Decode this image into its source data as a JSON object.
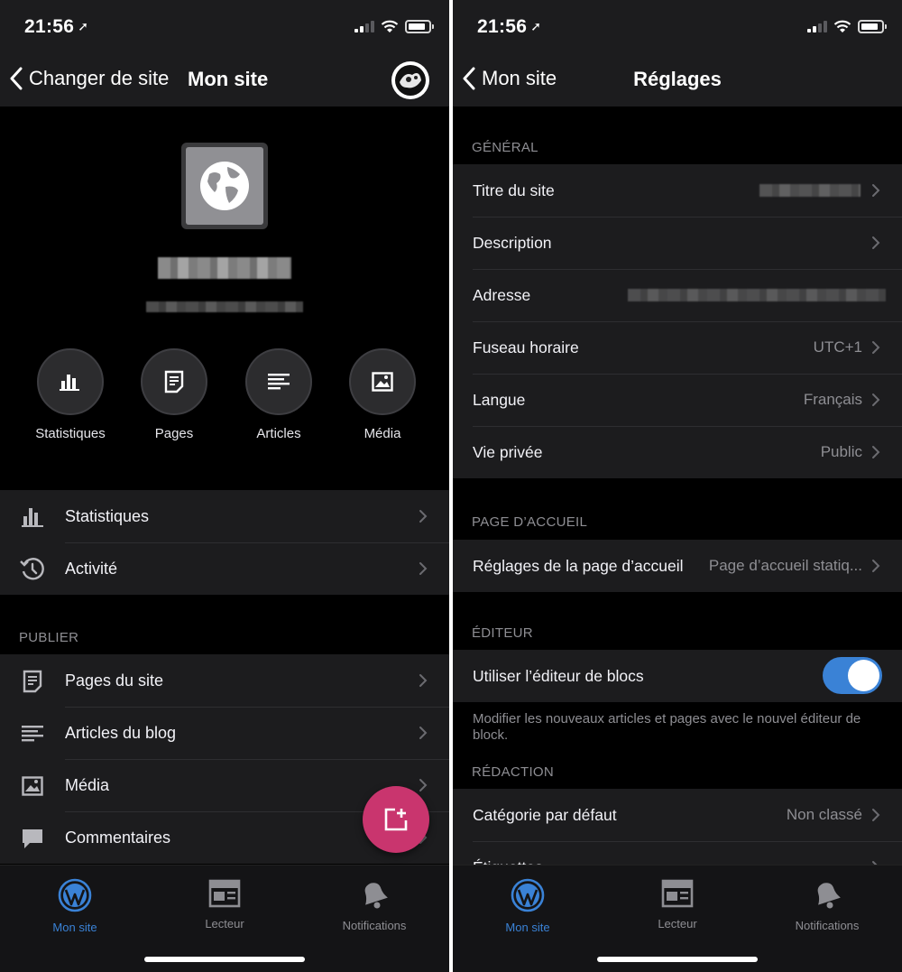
{
  "left": {
    "status": {
      "time": "21:56"
    },
    "nav": {
      "back_label": "Changer de site",
      "title": "Mon site"
    },
    "quick_actions": [
      {
        "label": "Statistiques",
        "icon": "stats-icon"
      },
      {
        "label": "Pages",
        "icon": "pages-icon"
      },
      {
        "label": "Articles",
        "icon": "articles-icon"
      },
      {
        "label": "Média",
        "icon": "media-icon"
      }
    ],
    "group1": [
      {
        "label": "Statistiques",
        "icon": "stats-icon"
      },
      {
        "label": "Activité",
        "icon": "history-icon"
      }
    ],
    "publish_header": "PUBLIER",
    "publish": [
      {
        "label": "Pages du site",
        "icon": "pages-icon"
      },
      {
        "label": "Articles du blog",
        "icon": "articles-icon"
      },
      {
        "label": "Média",
        "icon": "media-icon"
      },
      {
        "label": "Commentaires",
        "icon": "comment-icon"
      }
    ]
  },
  "right": {
    "status": {
      "time": "21:56"
    },
    "nav": {
      "back_label": "Mon site",
      "title": "Réglages"
    },
    "general_header": "GÉNÉRAL",
    "general": [
      {
        "label": "Titre du site",
        "value": ""
      },
      {
        "label": "Description",
        "value": ""
      },
      {
        "label": "Adresse",
        "value": ""
      },
      {
        "label": "Fuseau horaire",
        "value": "UTC+1"
      },
      {
        "label": "Langue",
        "value": "Français"
      },
      {
        "label": "Vie privée",
        "value": "Public"
      }
    ],
    "home_header": "PAGE D’ACCUEIL",
    "home": {
      "label": "Réglages de la page d’accueil",
      "value": "Page d’accueil statiq..."
    },
    "editor_header": "ÉDITEUR",
    "editor": {
      "label": "Utiliser l’éditeur de blocs",
      "toggle_on": true,
      "footnote": "Modifier les nouveaux articles et pages avec le nouvel éditeur de block."
    },
    "writing_header": "RÉDACTION",
    "writing": [
      {
        "label": "Catégorie par défaut",
        "value": "Non classé"
      },
      {
        "label": "Étiquettes",
        "value": ""
      }
    ]
  },
  "tabs": [
    {
      "label": "Mon site",
      "icon": "wordpress-icon",
      "active": true
    },
    {
      "label": "Lecteur",
      "icon": "reader-icon",
      "active": false
    },
    {
      "label": "Notifications",
      "icon": "bell-icon",
      "active": false
    }
  ],
  "colors": {
    "accent": "#3a82d6",
    "fab": "#c9356e",
    "background": "#000000",
    "surface": "#1c1c1e"
  }
}
